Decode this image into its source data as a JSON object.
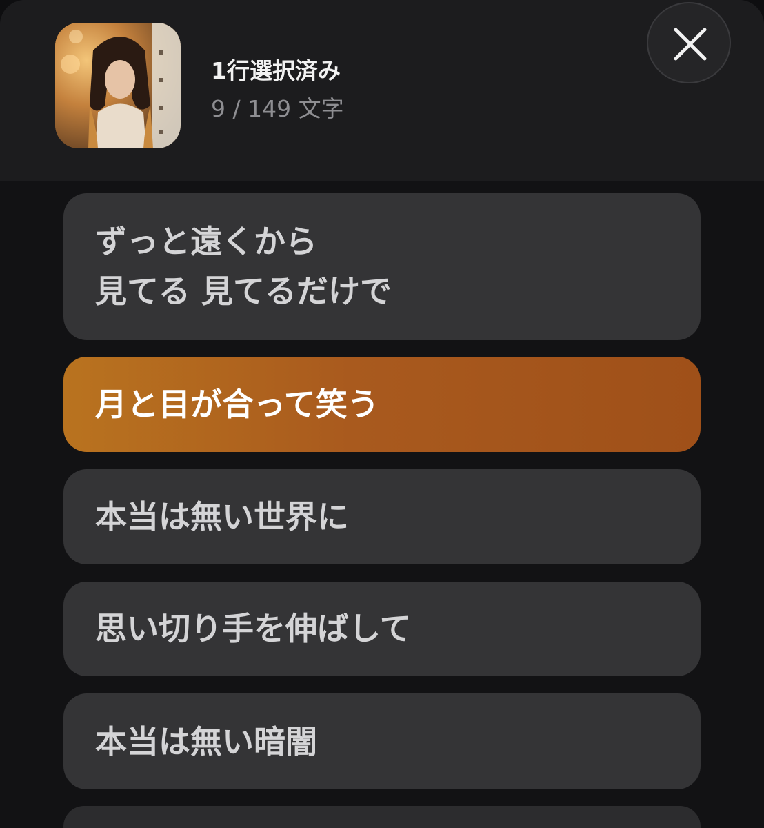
{
  "header": {
    "artwork_icon": "album-artwork",
    "title": "1行選択済み",
    "subtitle": "9 / 149 文字",
    "close_icon": "close-icon"
  },
  "lyrics": [
    {
      "lines": [
        "ずっと遠くから",
        "見てる 見てるだけで"
      ],
      "selected": false
    },
    {
      "lines": [
        "月と目が合って笑う"
      ],
      "selected": true
    },
    {
      "lines": [
        "本当は無い世界に"
      ],
      "selected": false
    },
    {
      "lines": [
        "思い切り手を伸ばして"
      ],
      "selected": false
    },
    {
      "lines": [
        "本当は無い暗闇"
      ],
      "selected": false
    }
  ],
  "colors": {
    "selected_accent": "#a95a1e",
    "row_background": "#343436",
    "sheet_background": "#1c1c1e"
  }
}
